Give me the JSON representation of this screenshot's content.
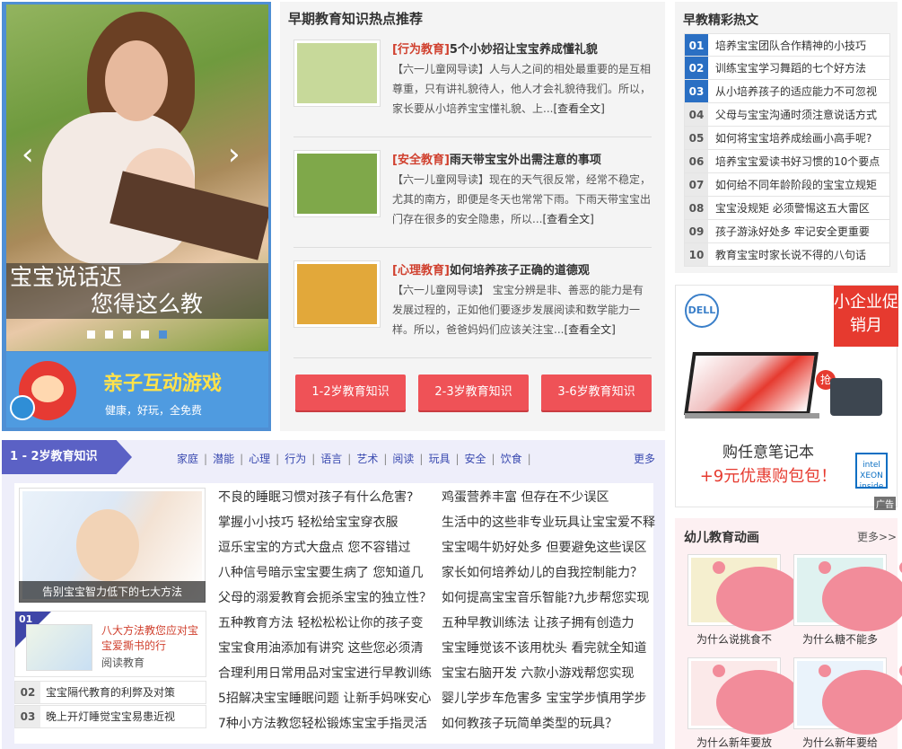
{
  "hero": {
    "caption_line1": "宝宝说话迟",
    "caption_line2": "您得这么教",
    "dots_count": 5,
    "active_dot_index": 4
  },
  "game_banner": {
    "title": "亲子互动游戏",
    "subtitle": "健康，好玩，全免费"
  },
  "hot": {
    "title": "早期教育知识热点推荐",
    "articles": [
      {
        "tag": "[行为教育]",
        "title": "5个小妙招让宝宝养成懂礼貌",
        "text": "【六一儿童网导读】人与人之间的相处最重要的是互相尊重，只有讲礼貌待人，他人才会礼貌待我们。所以，家长要从小培养宝宝懂礼貌、上...",
        "more": "[查看全文]",
        "thumb": "#c7d99a"
      },
      {
        "tag": "[安全教育]",
        "title": "雨天带宝宝外出需注意的事项",
        "text": "【六一儿童网导读】现在的天气很反常，经常不稳定，尤其的南方，即便是冬天也常常下雨。下雨天带宝宝出门存在很多的安全隐患，所以...",
        "more": "[查看全文]",
        "thumb": "#7fa84a"
      },
      {
        "tag": "[心理教育]",
        "title": "如何培养孩子正确的道德观",
        "text": "【六一儿童网导读】 宝宝分辨是非、善恶的能力是有发展过程的，正如他们要逐步发展阅读和数学能力一样。所以，爸爸妈妈们应该关注宝...",
        "more": "[查看全文]",
        "thumb": "#e2a83a"
      }
    ],
    "buttons": [
      "1-2岁教育知识",
      "2-3岁教育知识",
      "3-6岁教育知识"
    ]
  },
  "hotlist": {
    "title": "早教精彩热文",
    "items": [
      {
        "num": "01",
        "label": "培养宝宝团队合作精神的小技巧"
      },
      {
        "num": "02",
        "label": "训练宝宝学习舞蹈的七个好方法"
      },
      {
        "num": "03",
        "label": "从小培养孩子的适应能力不可忽视"
      },
      {
        "num": "04",
        "label": "父母与宝宝沟通时须注意说话方式"
      },
      {
        "num": "05",
        "label": "如何将宝宝培养成绘画小高手呢?"
      },
      {
        "num": "06",
        "label": "培养宝宝爱读书好习惯的10个要点"
      },
      {
        "num": "07",
        "label": "如何给不同年龄阶段的宝宝立规矩"
      },
      {
        "num": "08",
        "label": "宝宝没规矩 必须警惕这五大雷区"
      },
      {
        "num": "09",
        "label": "孩子游泳好处多 牢记安全更重要"
      },
      {
        "num": "10",
        "label": "教育宝宝时家长说不得的八句话"
      }
    ]
  },
  "ad": {
    "brand": "DELL",
    "promo": "小企业促销月",
    "qiang": "抢",
    "line1": "购任意笔记本",
    "line2": "+9元优惠购包包！",
    "intel": "intel XEON inside",
    "ad_label": "广告",
    "colors": {
      "accent": "#e63a2f",
      "brand": "#3a7fc9"
    }
  },
  "anim": {
    "title": "幼儿教育动画",
    "more": "更多>>",
    "items": [
      {
        "caption": "为什么说挑食不",
        "bg": "#f5efcf"
      },
      {
        "caption": "为什么糖不能多",
        "bg": "#dff2f0"
      },
      {
        "caption": "为什么新年要放",
        "bg": "#fbe9e9"
      },
      {
        "caption": "为什么新年要给",
        "bg": "#eaf3fb"
      }
    ]
  },
  "sec2": {
    "tab": "1 - 2岁教育知识",
    "nav": [
      "家庭",
      "潜能",
      "心理",
      "行为",
      "语言",
      "艺术",
      "阅读",
      "玩具",
      "安全",
      "饮食"
    ],
    "more": "更多",
    "feature_caption": "告别宝宝智力低下的七大方法",
    "top1": {
      "num": "01",
      "title": "八大方法教您应对宝宝爱撕书的行",
      "category": "阅读教育"
    },
    "small_items": [
      {
        "num": "02",
        "label": "宝宝隔代教育的利弊及对策"
      },
      {
        "num": "03",
        "label": "晚上开灯睡觉宝宝易患近视"
      }
    ],
    "col1": [
      "不良的睡眠习惯对孩子有什么危害?",
      "掌握小小技巧 轻松给宝宝穿衣服",
      "逗乐宝宝的方式大盘点 您不容错过",
      "八种信号暗示宝宝要生病了 您知道几",
      "父母的溺爱教育会扼杀宝宝的独立性？",
      "五种教育方法 轻松松松让你的孩子变",
      "宝宝食用油添加有讲究 这些您必须清",
      "合理利用日常用品对宝宝进行早教训练",
      "5招解决宝宝睡眠问题 让新手妈咪安心",
      "7种小方法教您轻松锻炼宝宝手指灵活"
    ],
    "col2": [
      "鸡蛋营养丰富 但存在不少误区",
      "生活中的这些非专业玩具让宝宝爱不释",
      "宝宝喝牛奶好处多 但要避免这些误区",
      "家长如何培养幼儿的自我控制能力？",
      "如何提高宝宝音乐智能?九步帮您实现",
      "五种早教训练法 让孩子拥有创造力",
      "宝宝睡觉该不该用枕头 看完就全知道",
      "宝宝右脑开发 六款小游戏帮您实现",
      "婴儿学步车危害多 宝宝学步慎用学步",
      "如何教孩子玩简单类型的玩具？"
    ]
  }
}
